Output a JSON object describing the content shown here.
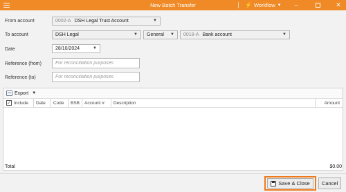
{
  "window": {
    "title": "New Batch Transfer",
    "workflow_label": "Workflow",
    "accent_color": "#f08a26"
  },
  "form": {
    "from_account": {
      "label": "From account",
      "code": "0002-A",
      "name": "DSH Legal Trust Account"
    },
    "to_account": {
      "label": "To account",
      "matter": "DSH Legal",
      "type": "General",
      "code": "0018-A",
      "name": "Bank account"
    },
    "date": {
      "label": "Date",
      "value": "28/10/2024"
    },
    "reference_from": {
      "label": "Reference (from)",
      "placeholder": "For reconciliation purposes"
    },
    "reference_to": {
      "label": "Reference (to)",
      "placeholder": "For reconciliation purposes"
    }
  },
  "grid": {
    "toolbar": {
      "export_label": "Export"
    },
    "columns": {
      "include": "Include",
      "date": "Date",
      "code": "Code",
      "bsb": "BSB",
      "account": "Account #",
      "description": "Description",
      "amount": "Amount"
    }
  },
  "total": {
    "label": "Total",
    "value": "$0.00"
  },
  "buttons": {
    "save_close": "Save & Close",
    "cancel": "Cancel"
  }
}
